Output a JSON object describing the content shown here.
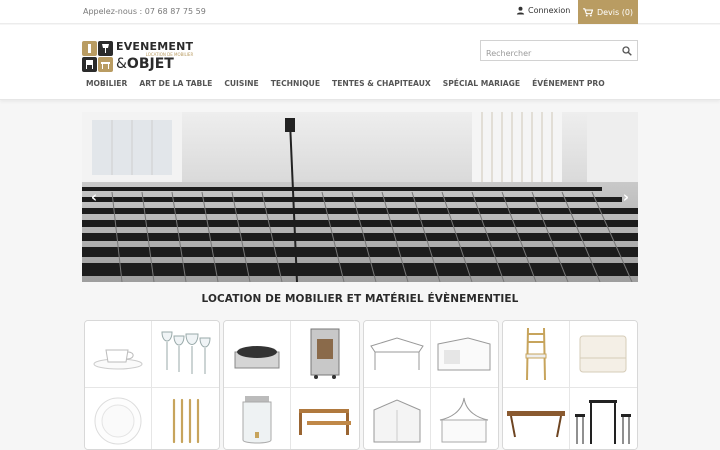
{
  "topbar": {
    "phone": "Appelez-nous : 07 68 87 75 59",
    "login_label": "Connexion",
    "cart_label": "Devis (0)"
  },
  "logo": {
    "line1": "EVENEMENT",
    "line2": "LOCATION DE MOBILIER",
    "amp": "&",
    "line3": "OBJET"
  },
  "search": {
    "placeholder": "Rechercher"
  },
  "nav": {
    "items": [
      "MOBILIER",
      "ART DE LA TABLE",
      "CUISINE",
      "TECHNIQUE",
      "TENTES & CHAPITEAUX",
      "SPÉCIAL MARIAGE",
      "ÉVÉNEMENT PRO"
    ]
  },
  "slider": {
    "prev_glyph": "‹",
    "next_glyph": "›",
    "image": "conference-room-folding-chairs"
  },
  "section": {
    "title": "LOCATION DE MOBILIER ET MATÉRIEL ÉVÈNEMENTIEL"
  },
  "categories": [
    [
      "cup-saucer",
      "wine-glasses",
      "white-plates",
      "gold-cutlery"
    ],
    [
      "crepe-maker",
      "warming-cabinet",
      "drink-dispenser",
      "wooden-display-risers"
    ],
    [
      "pop-up-tent",
      "side-tent",
      "folding-tent",
      "pagoda-tent"
    ],
    [
      "gold-chiavari-chair",
      "white-lounge-chair",
      "wooden-table",
      "high-bar-table"
    ]
  ],
  "colors": {
    "accent": "#b99c62",
    "text_dark": "#2a2a2a",
    "nav_text": "#555555"
  }
}
